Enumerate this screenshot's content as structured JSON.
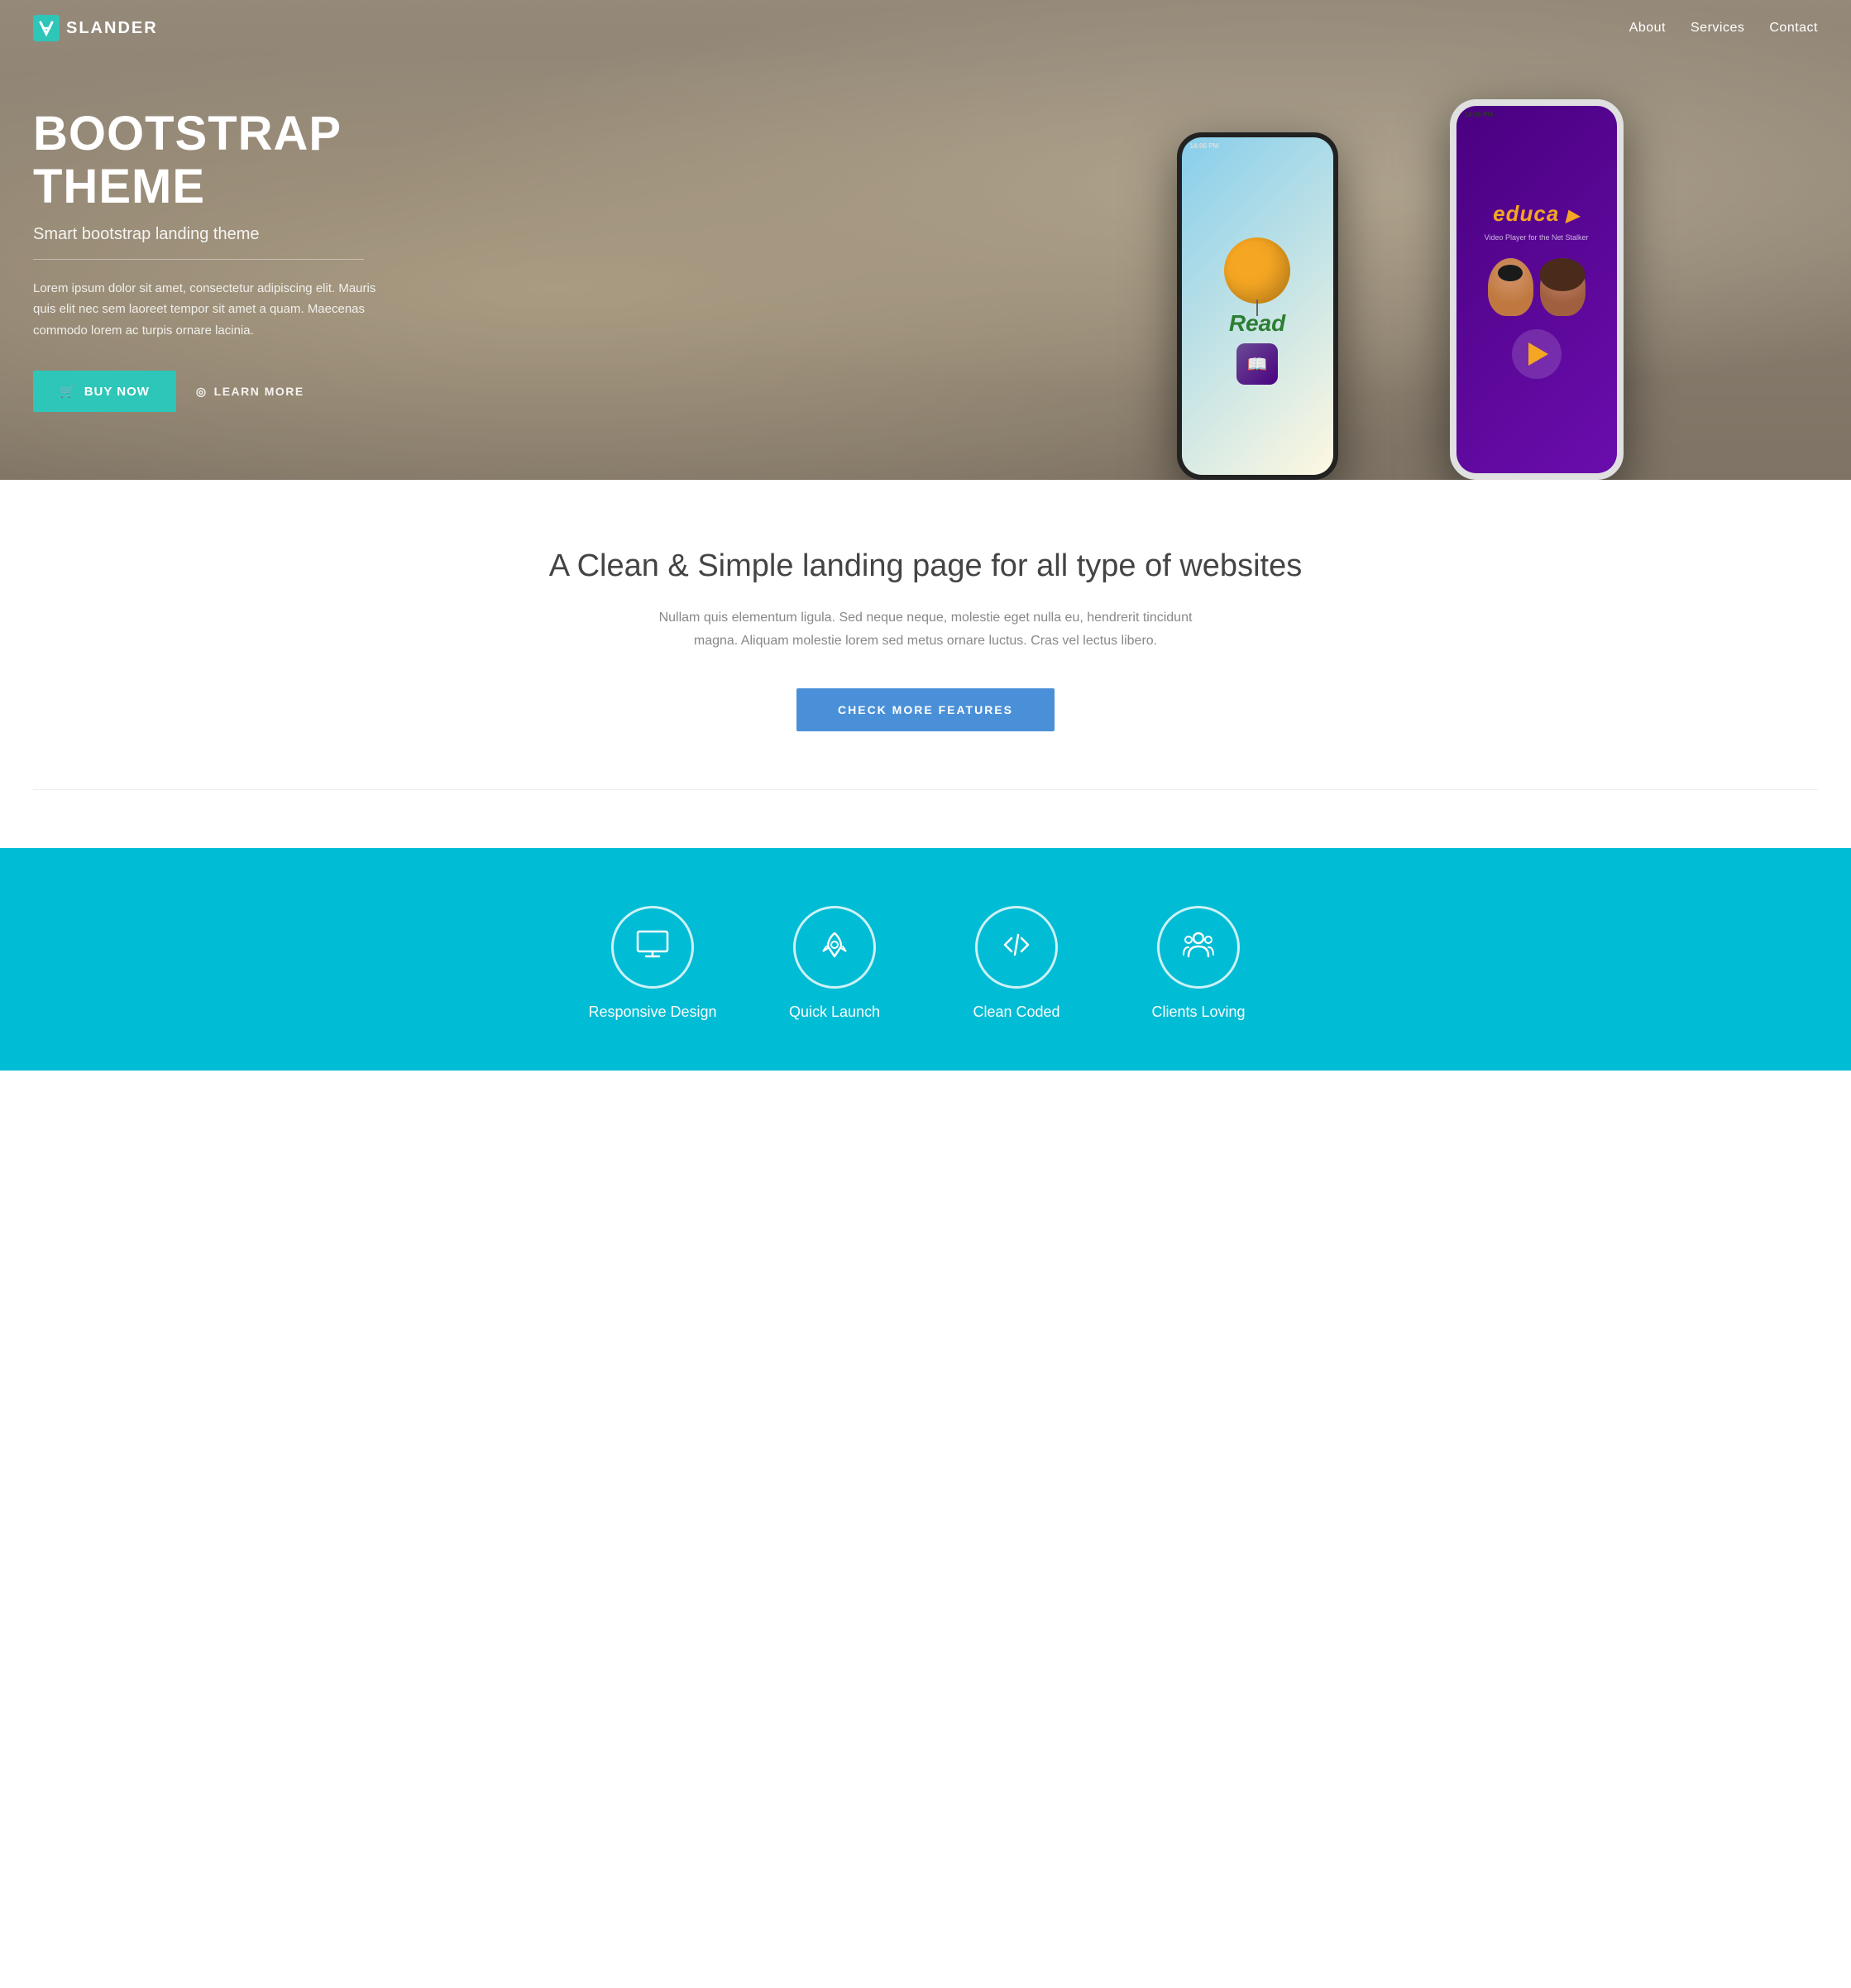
{
  "navbar": {
    "brand": "SLANDER",
    "brand_icon": "Z",
    "nav_items": [
      {
        "label": "About",
        "href": "#about"
      },
      {
        "label": "Services",
        "href": "#services"
      },
      {
        "label": "Contact",
        "href": "#contact"
      }
    ]
  },
  "hero": {
    "title_line1": "BOOTSTRAP",
    "title_line2": "THEME",
    "subtitle": "Smart bootstrap landing theme",
    "description": "Lorem ipsum dolor sit amet, consectetur adipiscing elit. Mauris quis elit nec sem laoreet tempor sit amet a quam. Maecenas commodo lorem ac turpis ornare lacinia.",
    "btn_buy": "BUY NOW",
    "btn_learn": "LEARN MORE",
    "phone_black_time": "14:06 PM",
    "phone_white_time": "14:06 PM",
    "app1_label": "Read",
    "app2_label": "educa"
  },
  "mid_section": {
    "title": "A Clean & Simple landing page for all type of websites",
    "description": "Nullam quis elementum ligula. Sed neque neque, molestie eget nulla eu, hendrerit tincidunt magna. Aliquam molestie lorem sed metus ornare luctus. Cras vel lectus libero.",
    "btn_label": "CHECK MORE FEATURES"
  },
  "features": {
    "items": [
      {
        "label": "Responsive Design",
        "icon": "monitor"
      },
      {
        "label": "Quick Launch",
        "icon": "rocket"
      },
      {
        "label": "Clean Coded",
        "icon": "code"
      },
      {
        "label": "Clients Loving",
        "icon": "people"
      }
    ]
  }
}
